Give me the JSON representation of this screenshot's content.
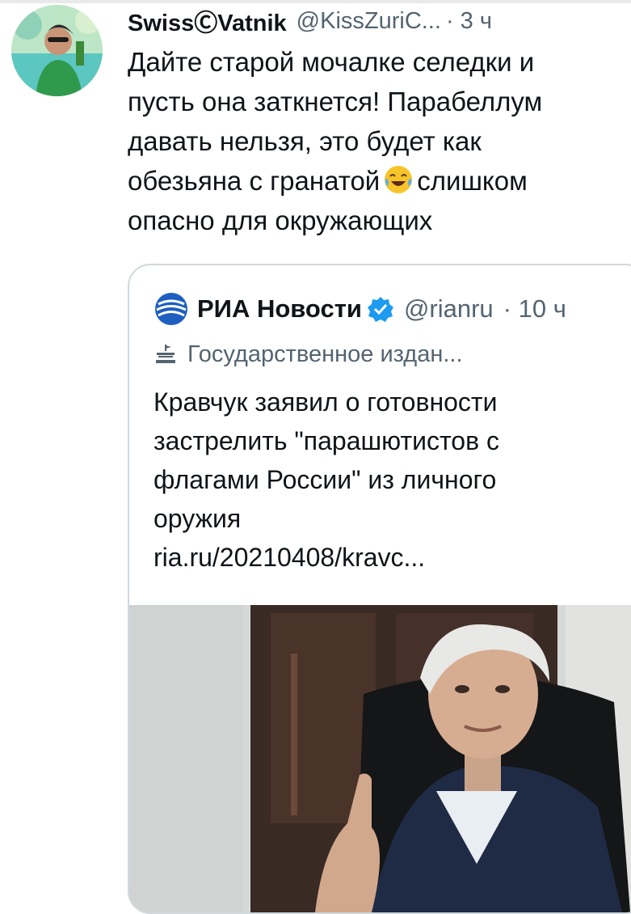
{
  "tweet": {
    "display_name": "SwissⒸVatnik",
    "handle": "@KissZuriC...",
    "time": "· 3 ч",
    "text_lines": [
      "Дайте старой мочалке селедки и",
      "пусть она заткнется! Парабеллум",
      "давать нельзя, это будет как",
      "обезьяна с гранатой",
      "слишком",
      "опасно для окружающих"
    ]
  },
  "quoted": {
    "display_name": "РИА Новости",
    "handle": "@rianru",
    "time": "· 10 ч",
    "label": "Государственное издан...",
    "text_lines": [
      "Кравчук заявил о готовности",
      "застрелить \"парашютистов с",
      "флагами России\" из личного",
      "оружия"
    ],
    "link": "ria.ru/20210408/kravc..."
  },
  "icons": {
    "avatar": "user-avatar",
    "verified": "verified-badge-icon",
    "ria_logo": "ria-logo",
    "gov": "government-building-icon",
    "emoji": "tears-of-joy-emoji"
  },
  "colors": {
    "secondary_text": "#536471",
    "verified": "#1d9bf0",
    "ria_blue": "#1e5fc0",
    "border": "#cfd9de"
  }
}
